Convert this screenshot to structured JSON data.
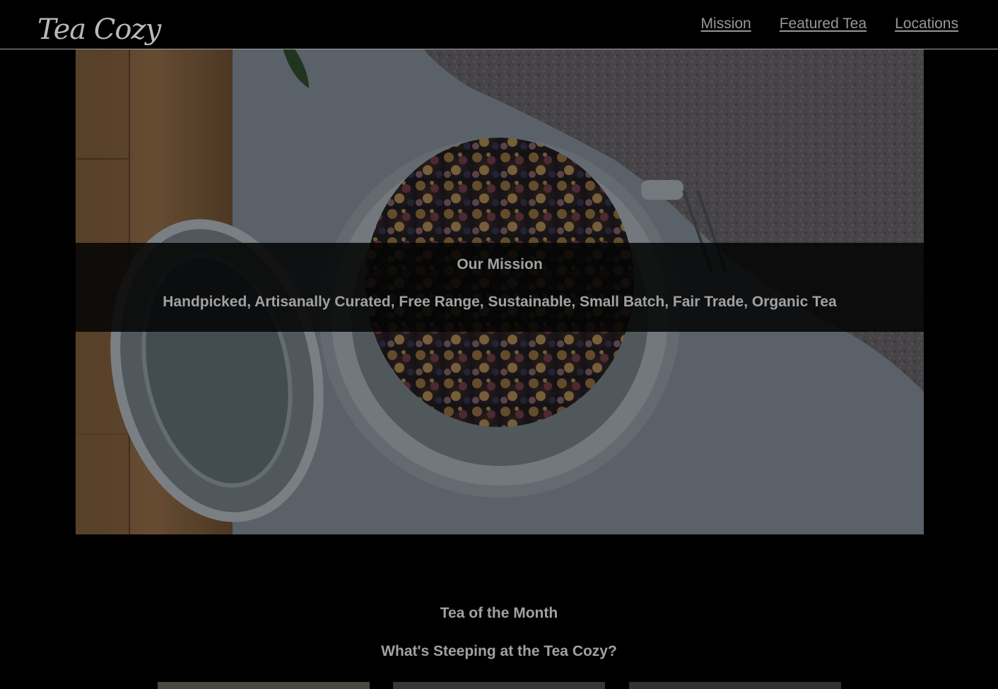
{
  "header": {
    "logo_text": "Tea Cozy",
    "nav": [
      {
        "label": "Mission"
      },
      {
        "label": "Featured Tea"
      },
      {
        "label": "Locations"
      }
    ]
  },
  "mission": {
    "title": "Our Mission",
    "text": "Handpicked, Artisanally Curated, Free Range, Sustainable, Small Batch, Fair Trade, Organic Tea"
  },
  "tea_of_month": {
    "title": "Tea of the Month",
    "subtitle": "What's Steeping at the Tea Cozy?"
  },
  "colors": {
    "background": "#000000",
    "text_gray": "#a1a1a1",
    "nav_gray": "#989898"
  }
}
